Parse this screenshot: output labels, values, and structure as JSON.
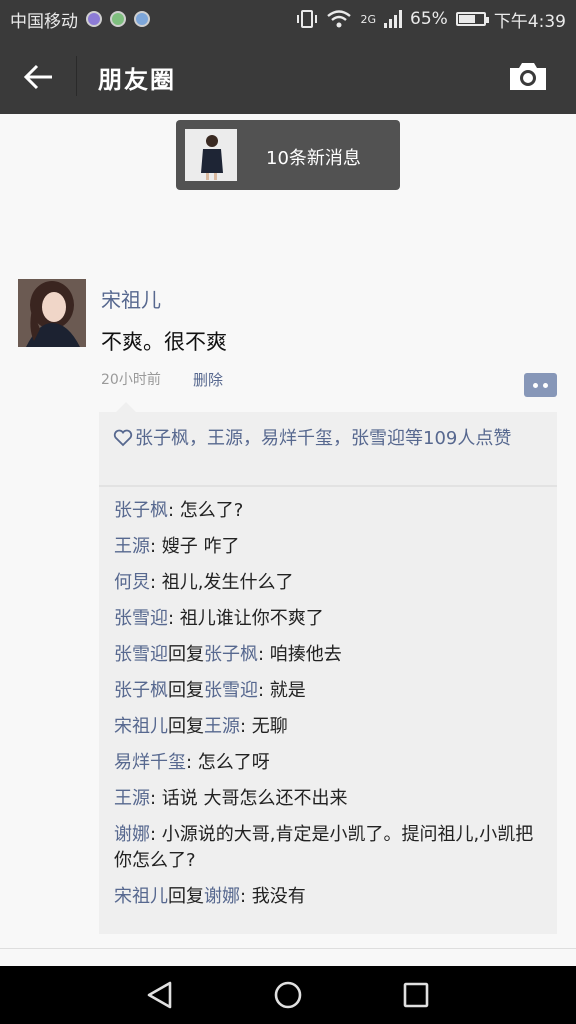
{
  "status": {
    "carrier": "中国移动",
    "network": "2G",
    "battery": "65%",
    "battery_level": 0.65,
    "time": "下午4:39"
  },
  "nav": {
    "title": "朋友圈"
  },
  "banner": {
    "text": "10条新消息"
  },
  "post": {
    "author": "宋祖儿",
    "content": "不爽。很不爽",
    "time": "20小时前",
    "delete": "删除"
  },
  "likes": {
    "text": "张子枫，王源，易烊千玺，张雪迎等109人点赞"
  },
  "comments": [
    {
      "name": "张子枫",
      "reply_to": "",
      "text": ": 怎么了?"
    },
    {
      "name": "王源",
      "reply_to": "",
      "text": ": 嫂子 咋了"
    },
    {
      "name": "何炅",
      "reply_to": "",
      "text": ": 祖儿,发生什么了"
    },
    {
      "name": "张雪迎",
      "reply_to": "",
      "text": ": 祖儿谁让你不爽了"
    },
    {
      "name": "张雪迎",
      "reply_word": "回复",
      "reply_to": "张子枫",
      "text": ": 咱揍他去"
    },
    {
      "name": "张子枫",
      "reply_word": "回复",
      "reply_to": "张雪迎",
      "text": ": 就是"
    },
    {
      "name": "宋祖儿",
      "reply_word": "回复",
      "reply_to": "王源",
      "text": ": 无聊"
    },
    {
      "name": "易烊千玺",
      "reply_to": "",
      "text": ": 怎么了呀"
    },
    {
      "name": "王源",
      "reply_to": "",
      "text": ": 话说 大哥怎么还不出来"
    },
    {
      "name": "谢娜",
      "reply_to": "",
      "text": ": 小源说的大哥,肯定是小凯了。提问祖儿,小凯把你怎么了?"
    },
    {
      "name": "宋祖儿",
      "reply_word": "回复",
      "reply_to": "谢娜",
      "text": ": 我没有"
    }
  ],
  "colors": {
    "bar": "#3a3a3a",
    "link": "#57688f",
    "panel": "#efefef"
  }
}
